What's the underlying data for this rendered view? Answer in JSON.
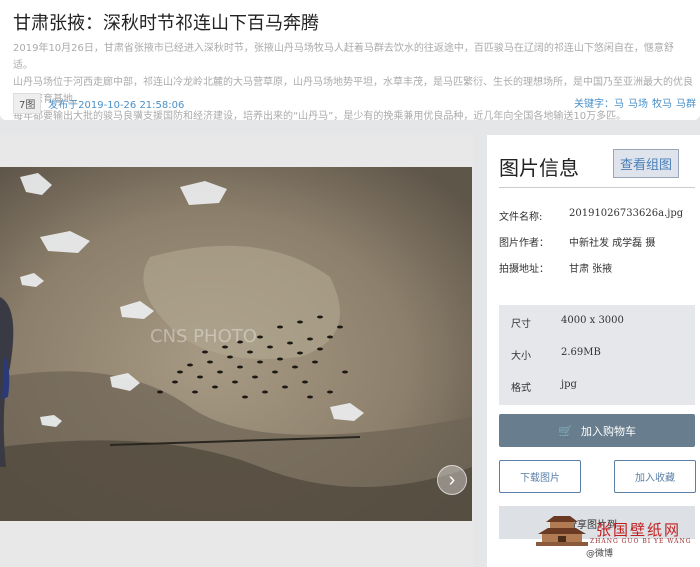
{
  "article": {
    "title": "甘肃张掖：深秋时节祁连山下百马奔腾",
    "desc_line1": "2019年10月26日，甘肃省张掖市已经进入深秋时节，张掖山丹马场牧马人赶着马群去饮水的往返途中，百匹骏马在辽阔的祁连山下悠闲自在，惬意舒适。",
    "desc_line2": "山丹马场位于河西走廊中部，祁连山冷龙岭北麓的大马营草原，山丹马场地势平坦，水草丰茂，是马匹繁衍、生长的理想场所，是中国乃至亚洲最大的优良马匹繁育基地，",
    "desc_line3": "每年都要输出大批的骏马良骥支援国防和经济建设，培养出来的“山丹马”，是少有的挽乘兼用优良品种，近几年向全国各地输送10万多匹。",
    "photo_count": "7图",
    "published": "发布于2019-10-26 21:58:06",
    "keywords_label": "关键字：",
    "keywords": [
      "马",
      "马场",
      "牧马",
      "马群"
    ]
  },
  "photo": {
    "watermark": "CNS PHOTO"
  },
  "info": {
    "title": "图片信息",
    "view_group_label": "查看组图",
    "filename_label": "文件名称:",
    "filename": "20191026733626a.jpg",
    "author_label": "图片作者：",
    "author": "中新社发 成学磊 摄",
    "location_label": "拍摄地址：",
    "location": "甘肃 张掖"
  },
  "spec": {
    "size_label": "尺寸",
    "size": "4000 x 3000",
    "filesize_label": "大小",
    "filesize": "2.69MB",
    "format_label": "格式",
    "format": "jpg"
  },
  "actions": {
    "add_cart": "加入购物车",
    "download": "下载图片",
    "favorite": "加入收藏",
    "share": "分享图片到"
  },
  "overlay": {
    "site_cn": "张国壁纸网",
    "site_en": "ZHANG GUO BI YE WANG",
    "weibo": "@微博"
  },
  "colors": {
    "accent": "#4a90c8",
    "cart_button": "#687d8d",
    "outline_button": "#5a7fa8"
  }
}
